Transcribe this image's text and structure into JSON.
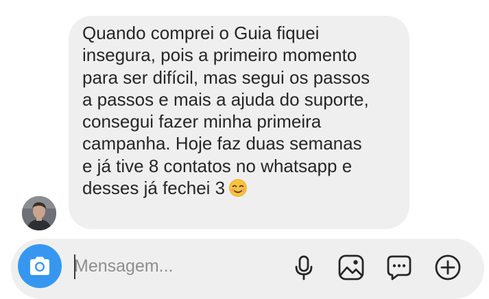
{
  "message": {
    "lines": [
      "Quando comprei o Guia fiquei",
      "insegura, pois a primeiro momento",
      "para ser difícil, mas segui os passos",
      "a passos e mais a ajuda do suporte,",
      "consegui fazer minha primeira",
      "campanha. Hoje faz duas semanas",
      "e já tive 8 contatos no whatsapp e",
      "desses já fechei 3"
    ],
    "emoji": "smiling-face-icon"
  },
  "composer": {
    "placeholder": "Mensagem...",
    "value": "",
    "icons": [
      "camera-icon",
      "microphone-icon",
      "image-icon",
      "chat-icon",
      "add-icon"
    ]
  },
  "colors": {
    "accent": "#3797f0",
    "bubble": "#efefef",
    "text": "#262626",
    "placeholder": "#8e8e8e"
  }
}
